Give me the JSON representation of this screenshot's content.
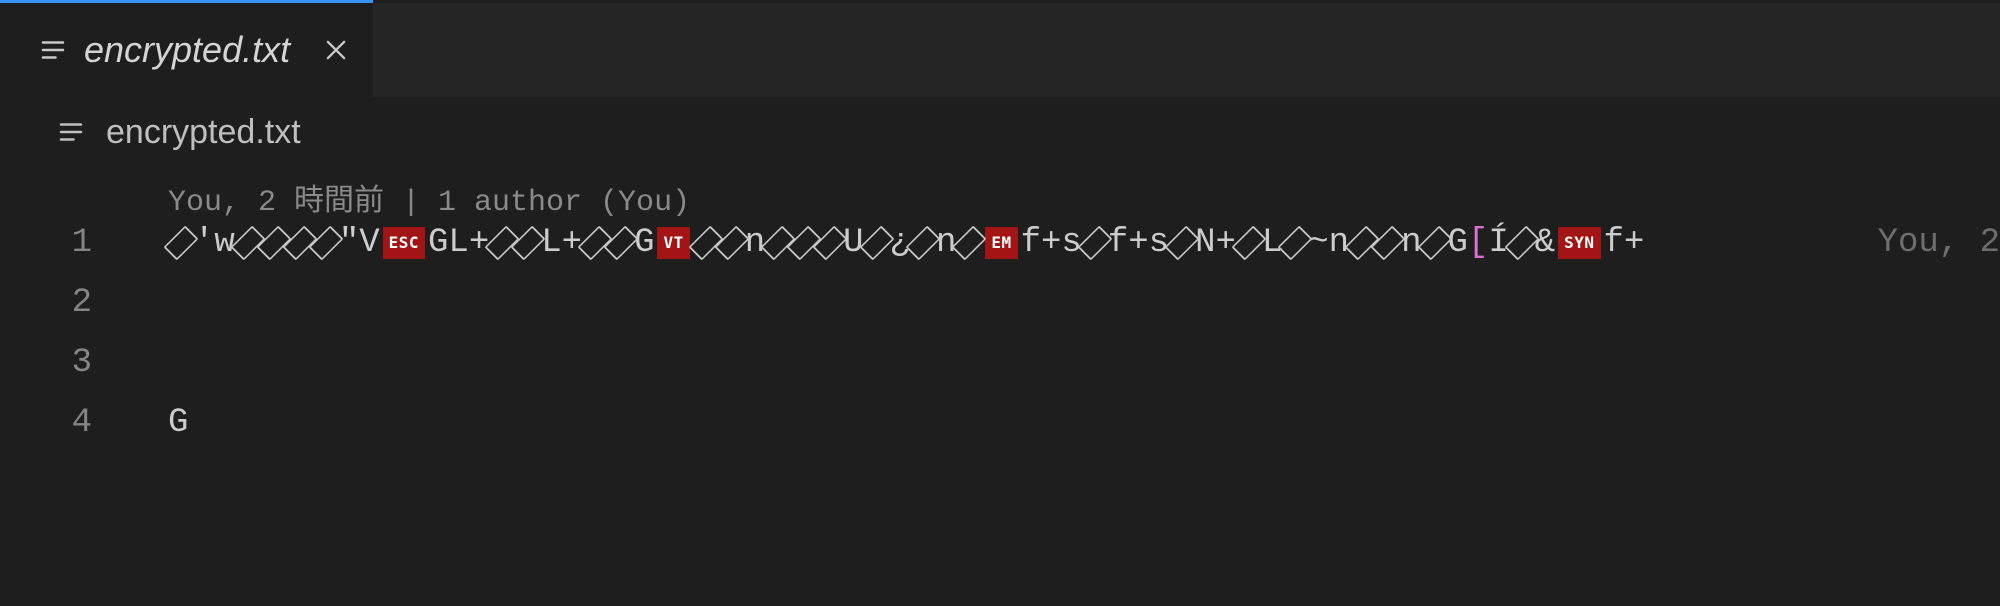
{
  "tab": {
    "filename": "encrypted.txt",
    "close_tooltip": "Close"
  },
  "breadcrumb": {
    "filename": "encrypted.txt"
  },
  "blame": {
    "text": "You, 2 時間前 | 1 author (You)"
  },
  "gutter": [
    "1",
    "2",
    "3",
    "4"
  ],
  "line1": {
    "tokens": [
      {
        "t": "unk"
      },
      {
        "t": "txt",
        "v": "'w"
      },
      {
        "t": "unk"
      },
      {
        "t": "unk"
      },
      {
        "t": "unk"
      },
      {
        "t": "unk"
      },
      {
        "t": "txt",
        "v": "\"V"
      },
      {
        "t": "ctrl",
        "v": "ESC"
      },
      {
        "t": "txt",
        "v": "GL+"
      },
      {
        "t": "unk"
      },
      {
        "t": "unk"
      },
      {
        "t": "txt",
        "v": "L+"
      },
      {
        "t": "unk"
      },
      {
        "t": "unk"
      },
      {
        "t": "txt",
        "v": "G"
      },
      {
        "t": "ctrl",
        "v": "VT"
      },
      {
        "t": "unk"
      },
      {
        "t": "unk"
      },
      {
        "t": "txt",
        "v": "n"
      },
      {
        "t": "unk"
      },
      {
        "t": "unk"
      },
      {
        "t": "unk"
      },
      {
        "t": "txt",
        "v": "U"
      },
      {
        "t": "unk"
      },
      {
        "t": "txt",
        "v": "¿"
      },
      {
        "t": "unk"
      },
      {
        "t": "txt",
        "v": "n"
      },
      {
        "t": "unk"
      },
      {
        "t": "ctrl",
        "v": "EM"
      },
      {
        "t": "txt",
        "v": "f+s"
      },
      {
        "t": "unk"
      },
      {
        "t": "txt",
        "v": "f+s"
      },
      {
        "t": "unk"
      },
      {
        "t": "txt",
        "v": "N+"
      },
      {
        "t": "unk"
      },
      {
        "t": "txt",
        "v": "L"
      },
      {
        "t": "unk"
      },
      {
        "t": "txt",
        "v": "~n"
      },
      {
        "t": "unk"
      },
      {
        "t": "unk"
      },
      {
        "t": "txt",
        "v": "n"
      },
      {
        "t": "unk"
      },
      {
        "t": "txt",
        "v": "G"
      },
      {
        "t": "brkt",
        "v": "["
      },
      {
        "t": "txt",
        "v": "Í"
      },
      {
        "t": "unk"
      },
      {
        "t": "txt",
        "v": "&"
      },
      {
        "t": "ctrl",
        "v": "SYN"
      },
      {
        "t": "txt",
        "v": "f+"
      }
    ],
    "hint": "You, 2"
  },
  "line4": {
    "text": "G"
  }
}
